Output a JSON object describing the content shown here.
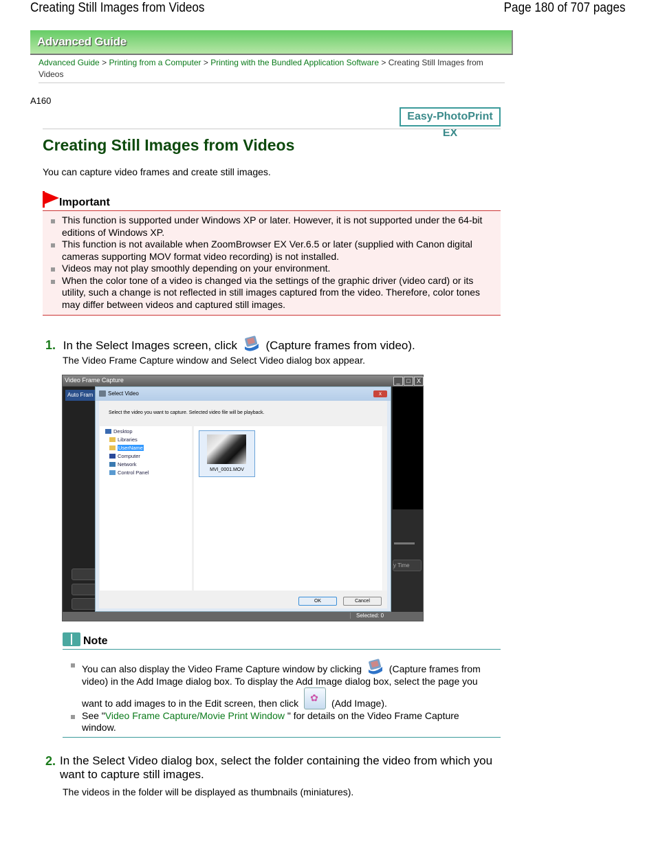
{
  "header": {
    "title": "Creating Still Images from Videos",
    "page_indicator": "Page 180 of 707 pages"
  },
  "banner": {
    "label": "Advanced Guide"
  },
  "breadcrumb": {
    "items": [
      {
        "label": "Advanced Guide",
        "link": true
      },
      {
        "label": "Printing from a Computer",
        "link": true
      },
      {
        "label": "Printing with the Bundled Application Software",
        "link": true
      },
      {
        "label": "Creating Still Images from Videos",
        "link": false
      }
    ],
    "separator": ">"
  },
  "doc_code": "A160",
  "product_logo": "Easy-PhotoPrint EX",
  "page_title": "Creating Still Images from Videos",
  "intro": "You can capture video frames and create still images.",
  "important": {
    "label": "Important",
    "items": [
      "This function is supported under Windows XP or later. However, it is not supported under the 64-bit editions of Windows XP.",
      "This function is not available when ZoomBrowser EX Ver.6.5 or later (supplied with Canon digital cameras supporting MOV format video recording) is not installed.",
      "Videos may not play smoothly depending on your environment.",
      "When the color tone of a video is changed via the settings of the graphic driver (video card) or its utility, such a change is not reflected in still images captured from the video. Therefore, color tones may differ between videos and captured still images."
    ]
  },
  "steps": [
    {
      "number": "1.",
      "text_before": "In the Select Images screen, click",
      "icon": "capture-frames-icon",
      "text_after": "(Capture frames from video).",
      "sub": "The Video Frame Capture window and Select Video dialog box appear."
    },
    {
      "number": "2.",
      "text": "In the Select Video dialog box, select the folder containing the video from which you want to capture still images.",
      "sub": "The videos in the folder will be displayed as thumbnails (miniatures)."
    }
  ],
  "screenshot": {
    "window_title": "Video Frame Capture",
    "tab_label": "Auto Fram",
    "window_buttons": [
      "_",
      "□",
      "X"
    ],
    "play_time_label": "y Time",
    "status": "Selected: 0",
    "dialog": {
      "title": "Select Video",
      "close": "x",
      "instruction": "Select the video you want to capture. Selected video file will be playback.",
      "tree": [
        {
          "label": "Desktop",
          "selected": false
        },
        {
          "label": "Libraries",
          "selected": false
        },
        {
          "label": "UserName",
          "selected": true
        },
        {
          "label": "Computer",
          "selected": false
        },
        {
          "label": "Network",
          "selected": false
        },
        {
          "label": "Control Panel",
          "selected": false
        }
      ],
      "file": "MVI_0001.MOV",
      "ok": "OK",
      "cancel": "Cancel"
    }
  },
  "note": {
    "label": "Note",
    "item1": {
      "part1": "You can also display the Video Frame Capture window by clicking",
      "part2": "(Capture frames from video) in the Add Image dialog box. To display the Add Image dialog box, select the page you want to add images to in the Edit screen, then click",
      "part3": "(Add Image)."
    },
    "item2": {
      "before": "See \"",
      "link": "Video Frame Capture/Movie Print Window",
      "after": " \" for details on the Video Frame Capture window."
    }
  },
  "colors": {
    "banner_green": "#66cc66",
    "link_green": "#0a7a1a",
    "title_green": "#0d4a0d",
    "important_red": "#cc3333",
    "important_bg": "#fdeeee",
    "note_teal": "#3a9a9a"
  }
}
